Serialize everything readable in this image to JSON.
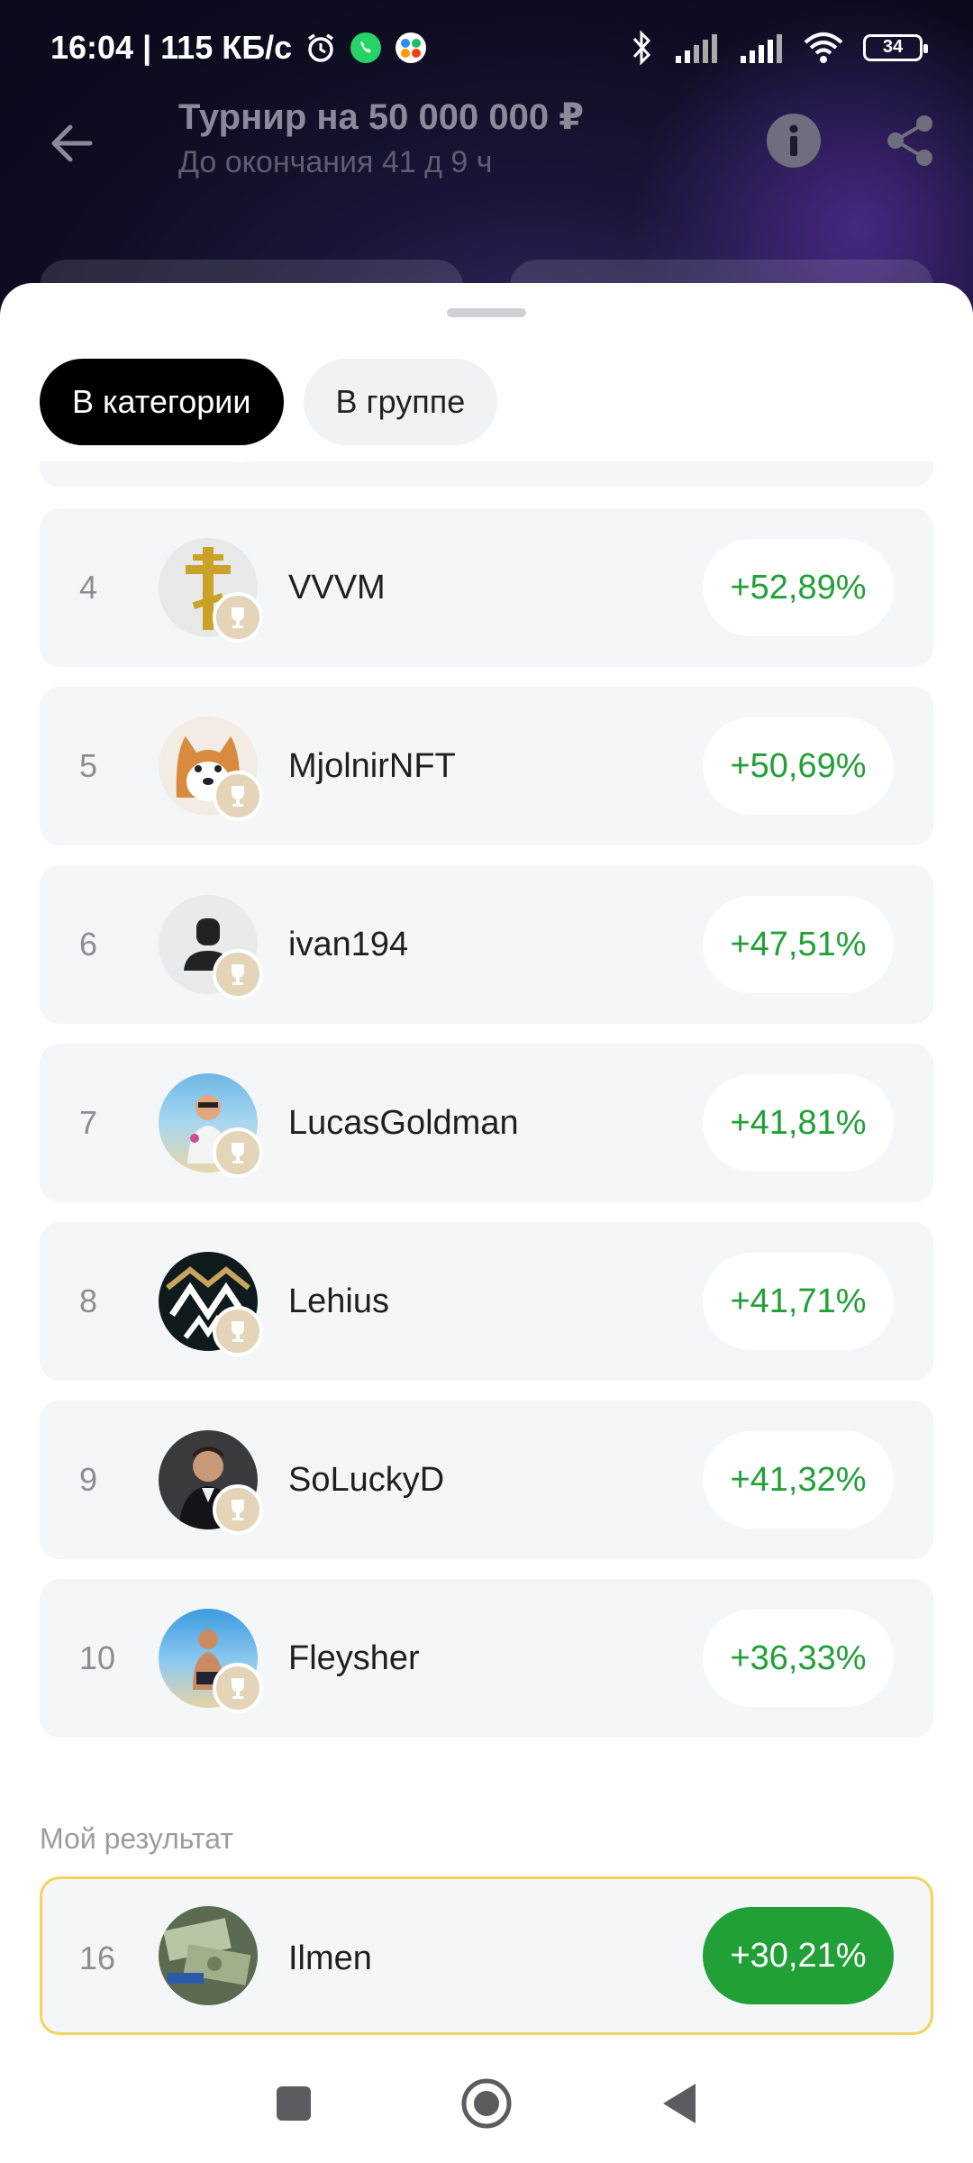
{
  "status_bar": {
    "time_speed": "16:04 | 115 КБ/с",
    "battery": "34"
  },
  "header": {
    "title": "Турнир на 50 000 000 ₽",
    "subtitle": "До окончания 41 д 9 ч"
  },
  "tabs": [
    {
      "label": "В категории",
      "active": true
    },
    {
      "label": "В группе",
      "active": false
    }
  ],
  "leaderboard": [
    {
      "rank": "4",
      "name": "VVVM",
      "result": "+52,89%",
      "avatar": "cross-icon"
    },
    {
      "rank": "5",
      "name": "MjolnirNFT",
      "result": "+50,69%",
      "avatar": "dog-icon"
    },
    {
      "rank": "6",
      "name": "ivan194",
      "result": "+47,51%",
      "avatar": "person-icon"
    },
    {
      "rank": "7",
      "name": "LucasGoldman",
      "result": "+41,81%",
      "avatar": "beach-person-icon"
    },
    {
      "rank": "8",
      "name": "Lehius",
      "result": "+41,71%",
      "avatar": "mountain-logo-icon"
    },
    {
      "rank": "9",
      "name": "SoLuckyD",
      "result": "+41,32%",
      "avatar": "man-suit-icon"
    },
    {
      "rank": "10",
      "name": "Fleysher",
      "result": "+36,33%",
      "avatar": "beach-person-icon"
    }
  ],
  "my_result": {
    "label": "Мой результат",
    "rank": "16",
    "name": "Ilmen",
    "result": "+30,21%",
    "avatar": "money-icon"
  },
  "colors": {
    "positive": "#21a038",
    "highlight_border": "#f0d55e",
    "card_bg": "#f5f6f7"
  }
}
